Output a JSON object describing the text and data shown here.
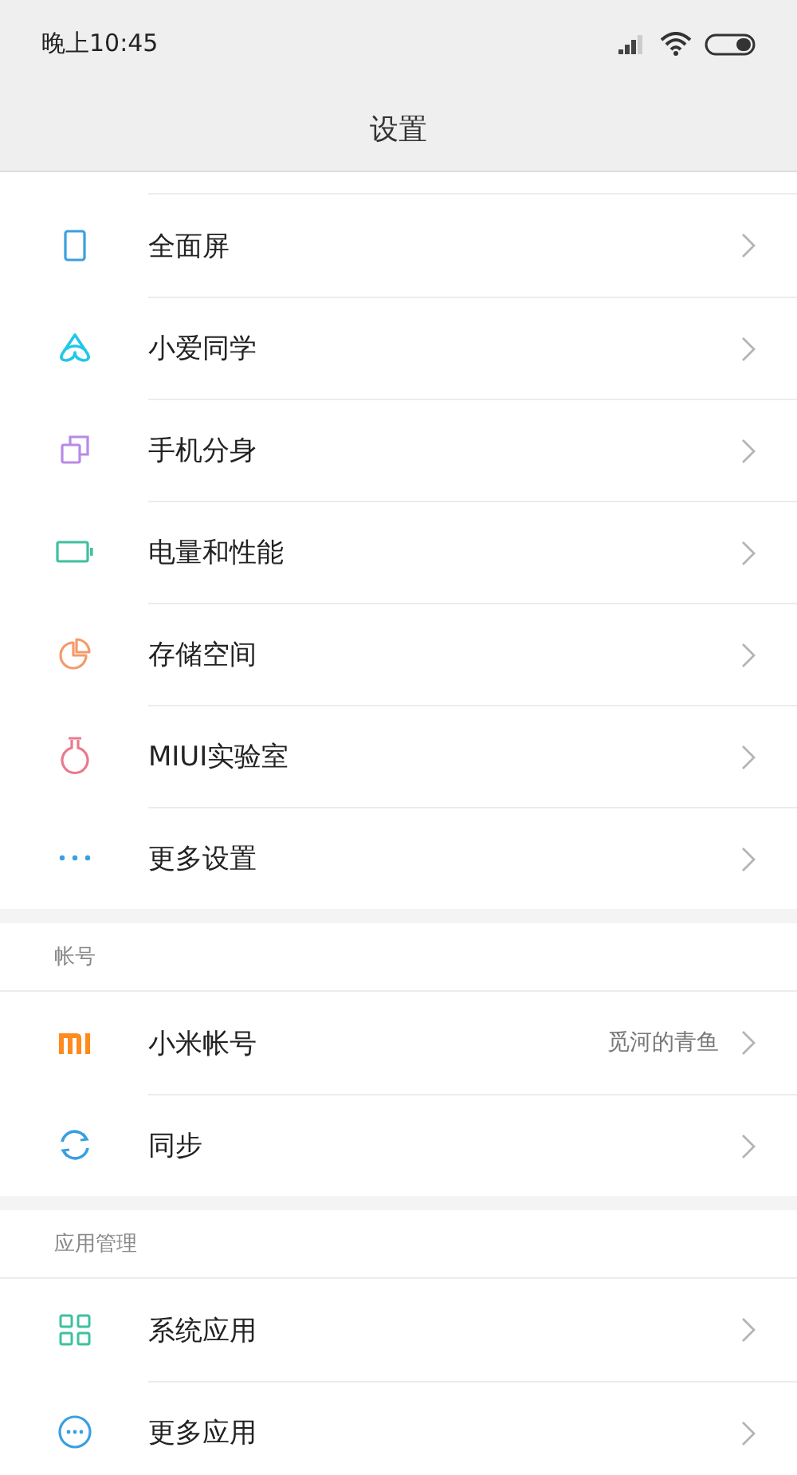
{
  "status_bar": {
    "time": "晚上10:45"
  },
  "title": "设置",
  "sections": [
    {
      "items": [
        {
          "kind": "phone",
          "label": "全面屏"
        },
        {
          "kind": "assistant",
          "label": "小爱同学"
        },
        {
          "kind": "clone",
          "label": "手机分身"
        },
        {
          "kind": "battery",
          "label": "电量和性能"
        },
        {
          "kind": "storage",
          "label": "存储空间"
        },
        {
          "kind": "flask",
          "label": "MIUI实验室"
        },
        {
          "kind": "dots",
          "label": "更多设置"
        }
      ]
    },
    {
      "header": "帐号",
      "items": [
        {
          "kind": "mi",
          "label": "小米帐号",
          "value": "觅河的青鱼"
        },
        {
          "kind": "sync",
          "label": "同步"
        }
      ]
    },
    {
      "header": "应用管理",
      "items": [
        {
          "kind": "grid",
          "label": "系统应用"
        },
        {
          "kind": "more",
          "label": "更多应用"
        }
      ]
    }
  ]
}
